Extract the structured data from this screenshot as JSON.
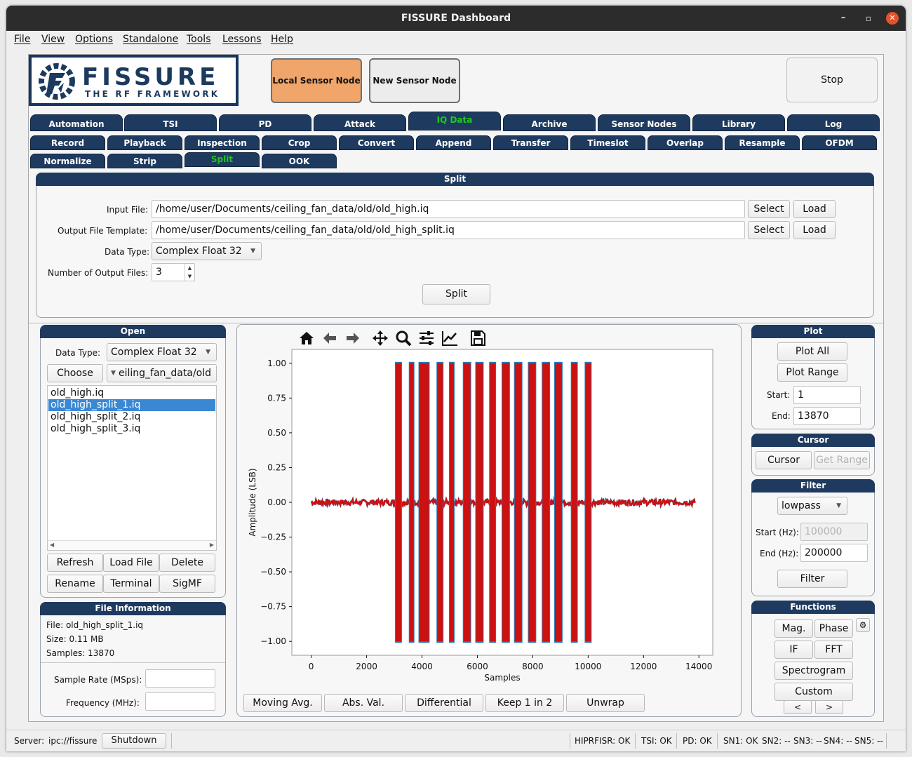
{
  "window": {
    "title": "FISSURE Dashboard",
    "minimize": "–",
    "maximize": "▫",
    "close": "✕"
  },
  "menu": [
    "File",
    "View",
    "Options",
    "Standalone",
    "Tools",
    "Lessons",
    "Help"
  ],
  "logo": {
    "title": "FISSURE",
    "subtitle": "THE RF FRAMEWORK"
  },
  "header": {
    "local_sensor": "Local Sensor Node",
    "new_sensor": "New Sensor Node",
    "stop": "Stop"
  },
  "tabs": [
    "Automation",
    "TSI",
    "PD",
    "Attack",
    "IQ Data",
    "Archive",
    "Sensor Nodes",
    "Library",
    "Log"
  ],
  "subtabs_row1": [
    "Record",
    "Playback",
    "Inspection",
    "Crop",
    "Convert",
    "Append",
    "Transfer",
    "Timeslot",
    "Overlap",
    "Resample",
    "OFDM"
  ],
  "subtabs_row2": [
    "Normalize",
    "Strip",
    "Split",
    "OOK"
  ],
  "split": {
    "title": "Split",
    "input_label": "Input File:",
    "input_value": "/home/user/Documents/ceiling_fan_data/old/old_high.iq",
    "output_label": "Output File Template:",
    "output_value": "/home/user/Documents/ceiling_fan_data/old/old_high_split.iq",
    "select": "Select",
    "load": "Load",
    "datatype_label": "Data Type:",
    "datatype_value": "Complex Float 32",
    "numfiles_label": "Number of Output Files:",
    "numfiles_value": "3",
    "split_button": "Split"
  },
  "open": {
    "title": "Open",
    "datatype_label": "Data Type:",
    "datatype_value": "Complex Float 32",
    "choose": "Choose",
    "folder": "eiling_fan_data/old",
    "files": [
      "old_high.iq",
      "old_high_split_1.iq",
      "old_high_split_2.iq",
      "old_high_split_3.iq"
    ],
    "selected_index": 1,
    "buttons": [
      "Refresh",
      "Load File",
      "Delete",
      "Rename",
      "Terminal",
      "SigMF"
    ]
  },
  "file_info": {
    "title": "File Information",
    "file": "File: old_high_split_1.iq",
    "size": "Size: 0.11 MB",
    "samples": "Samples: 13870",
    "sample_rate_label": "Sample Rate (MSps):",
    "sample_rate_value": "",
    "frequency_label": "Frequency (MHz):",
    "frequency_value": ""
  },
  "plot_toolbar": [
    "home-icon",
    "back-icon",
    "forward-icon",
    "pan-icon",
    "zoom-icon",
    "configure-icon",
    "edit-curve-icon",
    "save-icon"
  ],
  "plot_actions": [
    "Moving Avg.",
    "Abs. Val.",
    "Differential",
    "Keep 1 in 2",
    "Unwrap"
  ],
  "plot_panel": {
    "title": "Plot",
    "plot_all": "Plot All",
    "plot_range": "Plot Range",
    "start_label": "Start:",
    "start_value": "1",
    "end_label": "End:",
    "end_value": "13870"
  },
  "cursor_panel": {
    "title": "Cursor",
    "cursor": "Cursor",
    "get_range": "Get Range"
  },
  "filter_panel": {
    "title": "Filter",
    "type": "lowpass",
    "start_label": "Start (Hz):",
    "start_value": "100000",
    "end_label": "End (Hz):",
    "end_value": "200000",
    "filter": "Filter"
  },
  "functions_panel": {
    "title": "Functions",
    "buttons": [
      "Mag.",
      "Phase",
      "IF",
      "FFT",
      "Spectrogram",
      "Custom"
    ],
    "prev": "<",
    "next": ">"
  },
  "status": {
    "server_label": "Server:",
    "server_value": "ipc://fissure",
    "shutdown": "Shutdown",
    "hiprfisr": "HIPRFISR: OK",
    "tsi": "TSI: OK",
    "pd": "PD: OK",
    "sn1": "SN1: OK",
    "sn2": "SN2: --",
    "sn3": "SN3: --",
    "sn4": "SN4: --",
    "sn5": "SN5: --"
  },
  "colors": {
    "navy": "#1f3a5f",
    "active_tab_text": "#1ec81e",
    "local_sensor_bg": "#f0a56a",
    "signal_red": "#cc1111",
    "signal_blue": "#2a77b4"
  },
  "chart_data": {
    "type": "line",
    "xlabel": "Samples",
    "ylabel": "Amplitude (LSB)",
    "xlim": [
      -700,
      14500
    ],
    "ylim": [
      -1.1,
      1.1
    ],
    "xticks": [
      0,
      2000,
      4000,
      6000,
      8000,
      10000,
      12000,
      14000
    ],
    "yticks": [
      1.0,
      0.75,
      0.5,
      0.25,
      0.0,
      -0.25,
      -0.5,
      -0.75,
      -1.0
    ],
    "ytick_labels": [
      "1.00",
      "0.75",
      "0.50",
      "0.25",
      "0.00",
      "−0.25",
      "−0.50",
      "−0.75",
      "−1.00"
    ],
    "noise_range": [
      0,
      13870
    ],
    "noise_amplitude": 0.02,
    "bursts": [
      {
        "start": 3050,
        "end": 3250
      },
      {
        "start": 3550,
        "end": 3700
      },
      {
        "start": 3900,
        "end": 4250
      },
      {
        "start": 4550,
        "end": 4750
      },
      {
        "start": 5000,
        "end": 5150
      },
      {
        "start": 5500,
        "end": 5750
      },
      {
        "start": 5950,
        "end": 6200
      },
      {
        "start": 6450,
        "end": 6650
      },
      {
        "start": 6900,
        "end": 7150
      },
      {
        "start": 7350,
        "end": 7600
      },
      {
        "start": 7850,
        "end": 8100
      },
      {
        "start": 8350,
        "end": 8600
      },
      {
        "start": 8800,
        "end": 9050
      },
      {
        "start": 9400,
        "end": 9600
      },
      {
        "start": 9900,
        "end": 10100
      }
    ],
    "burst_amplitude": 1.0
  }
}
